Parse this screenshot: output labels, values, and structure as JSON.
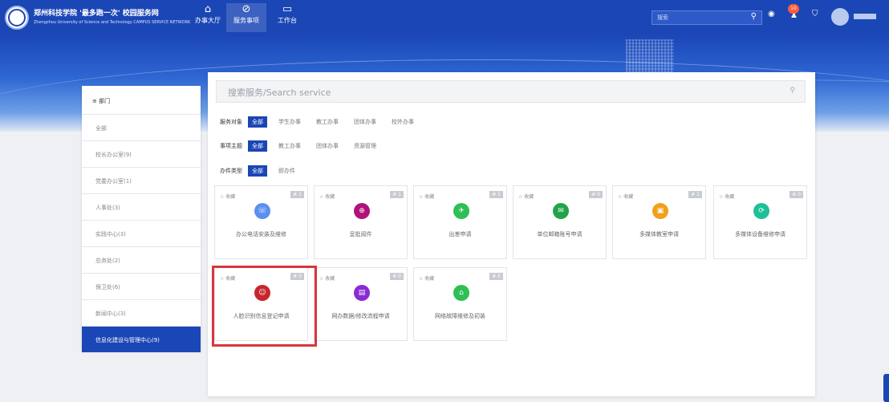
{
  "header": {
    "logo_text": "郑州科技学院 '最多跑一次' 校园服务网",
    "logo_sub": "Zhengzhou University of Science and Technology  CAMPUS SERVICE NETWORK",
    "nav": [
      {
        "label": "办事大厅",
        "icon": "home-icon",
        "glyph": "⌂"
      },
      {
        "label": "服务事项",
        "icon": "compass-icon",
        "glyph": "⊘"
      },
      {
        "label": "工作台",
        "icon": "monitor-icon",
        "glyph": "▭"
      }
    ],
    "search_placeholder": "搜索",
    "notifications": "10"
  },
  "sidebar": {
    "heading": "≡ 部门",
    "items": [
      {
        "label": "全部"
      },
      {
        "label": "校长办公室(9)"
      },
      {
        "label": "党委办公室(1)"
      },
      {
        "label": "人事处(3)"
      },
      {
        "label": "实践中心(3)"
      },
      {
        "label": "总务处(2)"
      },
      {
        "label": "保卫处(6)"
      },
      {
        "label": "新闻中心(3)"
      },
      {
        "label": "信息化建设与管理中心(9)"
      }
    ]
  },
  "search": {
    "placeholder": "搜索服务/Search service"
  },
  "filters": [
    {
      "label": "服务对象",
      "options": [
        "全部",
        "学生办事",
        "教工办事",
        "团体办事",
        "校外办事"
      ]
    },
    {
      "label": "事项主题",
      "options": [
        "全部",
        "教工办事",
        "团体办事",
        "资源管理"
      ]
    },
    {
      "label": "办件类型",
      "options": [
        "全部",
        "即办件"
      ]
    }
  ],
  "cards": [
    {
      "name": "办公电话安装及维修",
      "count": "# 1",
      "icon": "phone-icon",
      "glyph": "☏",
      "color": "#5b8ff0"
    },
    {
      "name": "呈批阅件",
      "count": "# 1",
      "icon": "globe-icon",
      "glyph": "⊕",
      "color": "#b0127a"
    },
    {
      "name": "出差申请",
      "count": "# 1",
      "icon": "airplane-icon",
      "glyph": "✈",
      "color": "#2fbf55"
    },
    {
      "name": "单位邮箱账号申请",
      "count": "# 0",
      "icon": "mail-icon",
      "glyph": "✉",
      "color": "#22a34a"
    },
    {
      "name": "多媒体教室申请",
      "count": "# 1",
      "icon": "screen-icon",
      "glyph": "▣",
      "color": "#f0a01a"
    },
    {
      "name": "多媒体设备维修申请",
      "count": "# 0",
      "icon": "repair-icon",
      "glyph": "⟳",
      "color": "#1fbf9a"
    },
    {
      "name": "人脸识别信息登记申请",
      "count": "# 0",
      "icon": "person-icon",
      "glyph": "☺",
      "color": "#c9252f"
    },
    {
      "name": "网办数据/修改流程申请",
      "count": "# 0",
      "icon": "document-icon",
      "glyph": "▤",
      "color": "#8a2bd6"
    },
    {
      "name": "网络故障维修及初装",
      "count": "# 0",
      "icon": "house-icon",
      "glyph": "⌂",
      "color": "#2fbf55"
    }
  ],
  "fav_label": "☆ 收藏"
}
